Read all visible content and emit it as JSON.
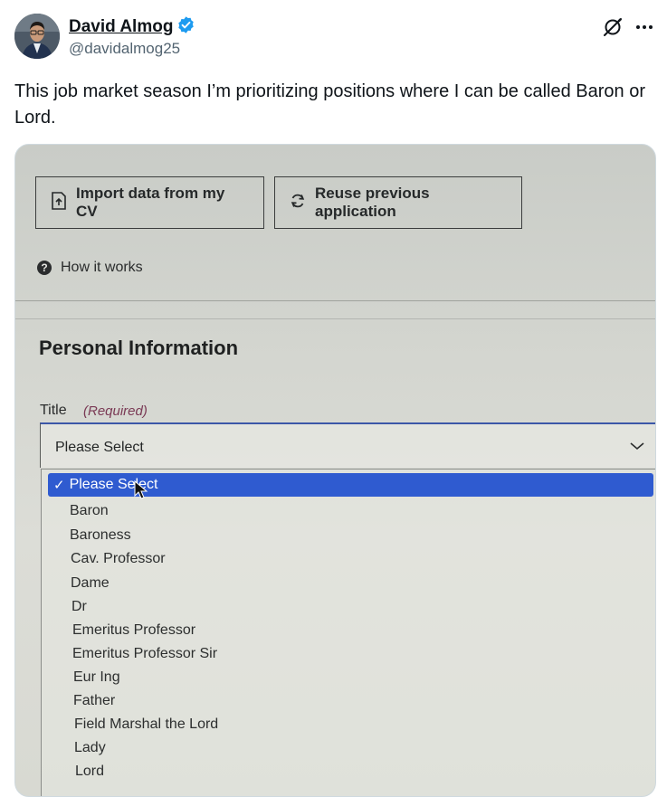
{
  "post": {
    "author_name": "David Almog",
    "handle": "@davidalmog25",
    "text": "This job market season I’m prioritizing positions where I can be called Baron or Lord."
  },
  "photo": {
    "buttons": {
      "import_label": "Import data from my CV",
      "reuse_label": "Reuse previous application"
    },
    "how_it_works": "How it works",
    "section_heading": "Personal Information",
    "field_label": "Title",
    "required_note": "(Required)",
    "select_value": "Please Select",
    "options": [
      "Please Select",
      "Baron",
      "Baroness",
      "Cav. Professor",
      "Dame",
      "Dr",
      "Emeritus Professor",
      "Emeritus Professor Sir",
      "Eur Ing",
      "Father",
      "Field Marshal the Lord",
      "Lady",
      "Lord"
    ]
  },
  "colors": {
    "verified_badge": "#1d9bf0",
    "selected_option": "#2f5bd0",
    "text_primary": "#0f1419",
    "text_secondary": "#536471"
  },
  "icons": [
    "verified-badge-icon",
    "grok-icon",
    "more-icon",
    "upload-icon",
    "refresh-icon",
    "question-icon",
    "chevron-down-icon",
    "checkmark-icon",
    "cursor-icon"
  ]
}
